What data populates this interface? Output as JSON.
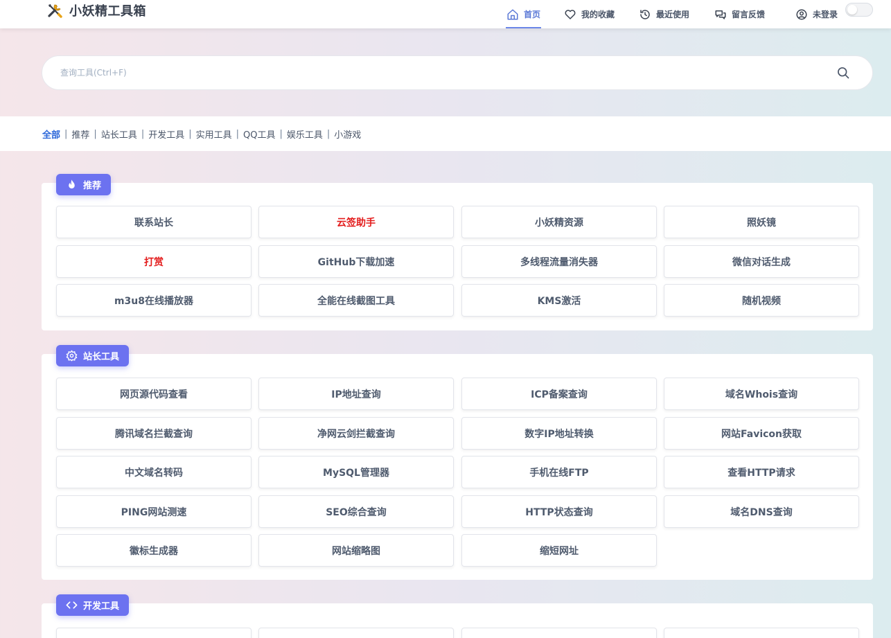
{
  "header": {
    "title": "小妖精工具箱",
    "nav": [
      {
        "label": "首页",
        "icon": "home-icon",
        "active": true
      },
      {
        "label": "我的收藏",
        "icon": "heart-icon"
      },
      {
        "label": "最近使用",
        "icon": "history-icon"
      },
      {
        "label": "留言反馈",
        "icon": "chat-icon"
      },
      {
        "label": "未登录",
        "icon": "user-icon"
      }
    ]
  },
  "search": {
    "placeholder": "查询工具(Ctrl+F)"
  },
  "categories": [
    "全部",
    "推荐",
    "站长工具",
    "开发工具",
    "实用工具",
    "QQ工具",
    "娱乐工具",
    "小游戏"
  ],
  "sections": [
    {
      "label": "推荐",
      "icon": "flame-icon",
      "tools": [
        {
          "label": "联系站长"
        },
        {
          "label": "云签助手",
          "highlight": true
        },
        {
          "label": "小妖精资源"
        },
        {
          "label": "照妖镜"
        },
        {
          "label": "打赏",
          "highlight": true
        },
        {
          "label": "GitHub下载加速"
        },
        {
          "label": "多线程流量消失器"
        },
        {
          "label": "微信对话生成"
        },
        {
          "label": "m3u8在线播放器"
        },
        {
          "label": "全能在线截图工具"
        },
        {
          "label": "KMS激活"
        },
        {
          "label": "随机视频"
        }
      ]
    },
    {
      "label": "站长工具",
      "icon": "gear-icon",
      "tools": [
        {
          "label": "网页源代码查看"
        },
        {
          "label": "IP地址查询"
        },
        {
          "label": "ICP备案查询"
        },
        {
          "label": "域名Whois查询"
        },
        {
          "label": "腾讯域名拦截查询"
        },
        {
          "label": "净网云剑拦截查询"
        },
        {
          "label": "数字IP地址转换"
        },
        {
          "label": "网站Favicon获取"
        },
        {
          "label": "中文域名转码"
        },
        {
          "label": "MySQL管理器"
        },
        {
          "label": "手机在线FTP"
        },
        {
          "label": "查看HTTP请求"
        },
        {
          "label": "PING网站测速"
        },
        {
          "label": "SEO综合查询"
        },
        {
          "label": "HTTP状态查询"
        },
        {
          "label": "域名DNS查询"
        },
        {
          "label": "徽标生成器"
        },
        {
          "label": "网站缩略图"
        },
        {
          "label": "缩短网址"
        }
      ]
    },
    {
      "label": "开发工具",
      "icon": "code-icon",
      "tools": []
    }
  ],
  "colors": {
    "accent": "#6c72f0",
    "highlight": "#e31b1b",
    "nav_active": "#5a78d6",
    "cat_active": "#2a66d9"
  }
}
